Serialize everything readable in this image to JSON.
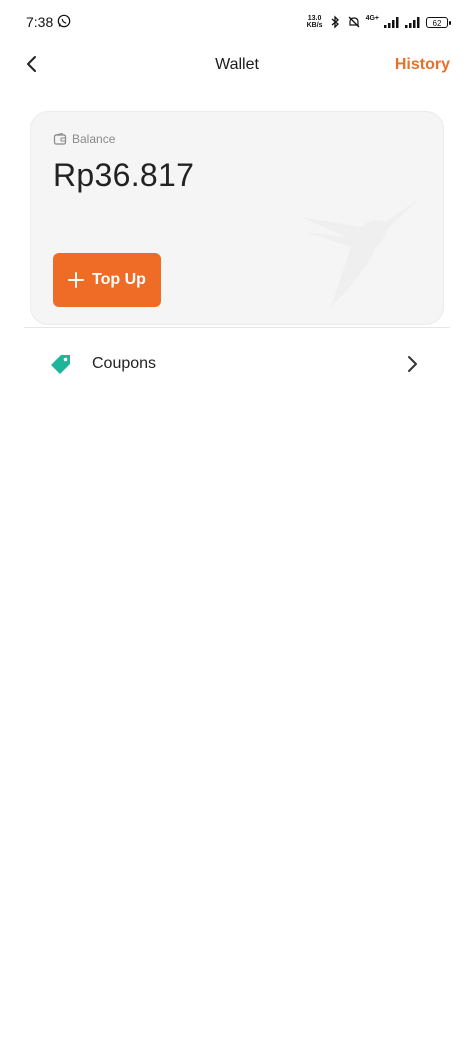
{
  "status_bar": {
    "time": "7:38",
    "net_speed_value": "13.0",
    "net_speed_unit": "KB/s",
    "network": "4G+",
    "battery": "62"
  },
  "header": {
    "title": "Wallet",
    "history_label": "History"
  },
  "balance": {
    "label": "Balance",
    "amount": "Rp36.817",
    "topup_label": "Top Up"
  },
  "coupons": {
    "label": "Coupons"
  },
  "colors": {
    "accent": "#ef6c26",
    "history": "#e8702a",
    "coupon": "#1fb59a"
  }
}
